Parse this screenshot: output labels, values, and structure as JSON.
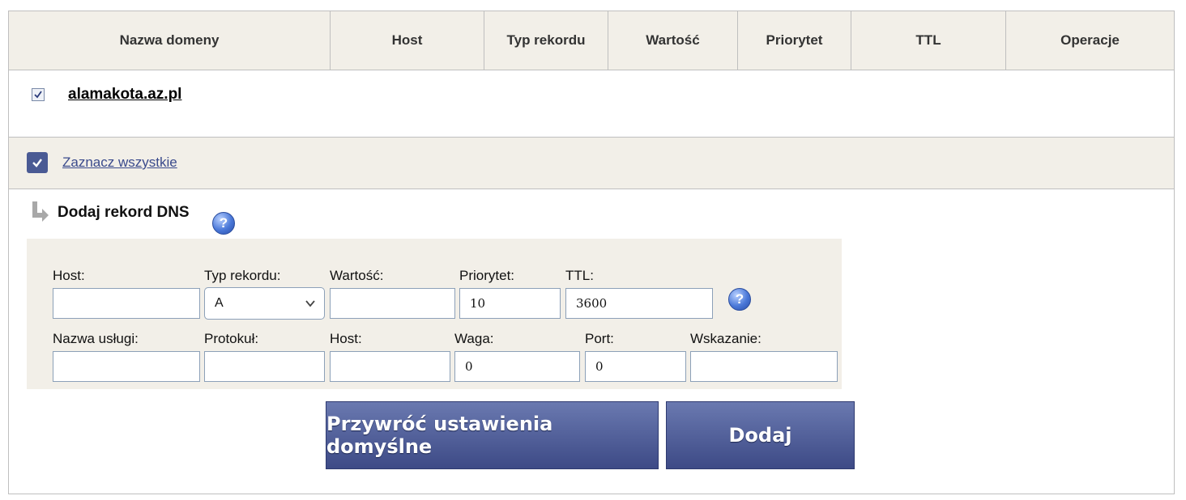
{
  "table": {
    "headers": [
      "Nazwa domeny",
      "Host",
      "Typ rekordu",
      "Wartość",
      "Priorytet",
      "TTL",
      "Operacje"
    ],
    "domain": "alamakota.az.pl",
    "select_all_label": "Zaznacz wszystkie"
  },
  "add_dns": {
    "title": "Dodaj rekord DNS",
    "labels": {
      "host": "Host:",
      "record_type": "Typ rekordu:",
      "value": "Wartość:",
      "priority": "Priorytet:",
      "ttl": "TTL:",
      "service_name": "Nazwa usługi:",
      "protocol": "Protokuł:",
      "host2": "Host:",
      "weight": "Waga:",
      "port": "Port:",
      "target": "Wskazanie:"
    },
    "values": {
      "host": "",
      "record_type": "A",
      "value": "",
      "priority": "10",
      "ttl": "3600",
      "service_name": "",
      "protocol": "",
      "host2": "",
      "weight": "0",
      "port": "0",
      "target": ""
    }
  },
  "buttons": {
    "reset": "Przywróć ustawienia domyślne",
    "add": "Dodaj"
  },
  "icons": {
    "help": "help-icon",
    "arrow": "arrow-down-right-icon",
    "check": "check-icon"
  },
  "colors": {
    "header_bg": "#f2efe8",
    "button": "#4a5a94",
    "link": "#3a4a8c"
  }
}
